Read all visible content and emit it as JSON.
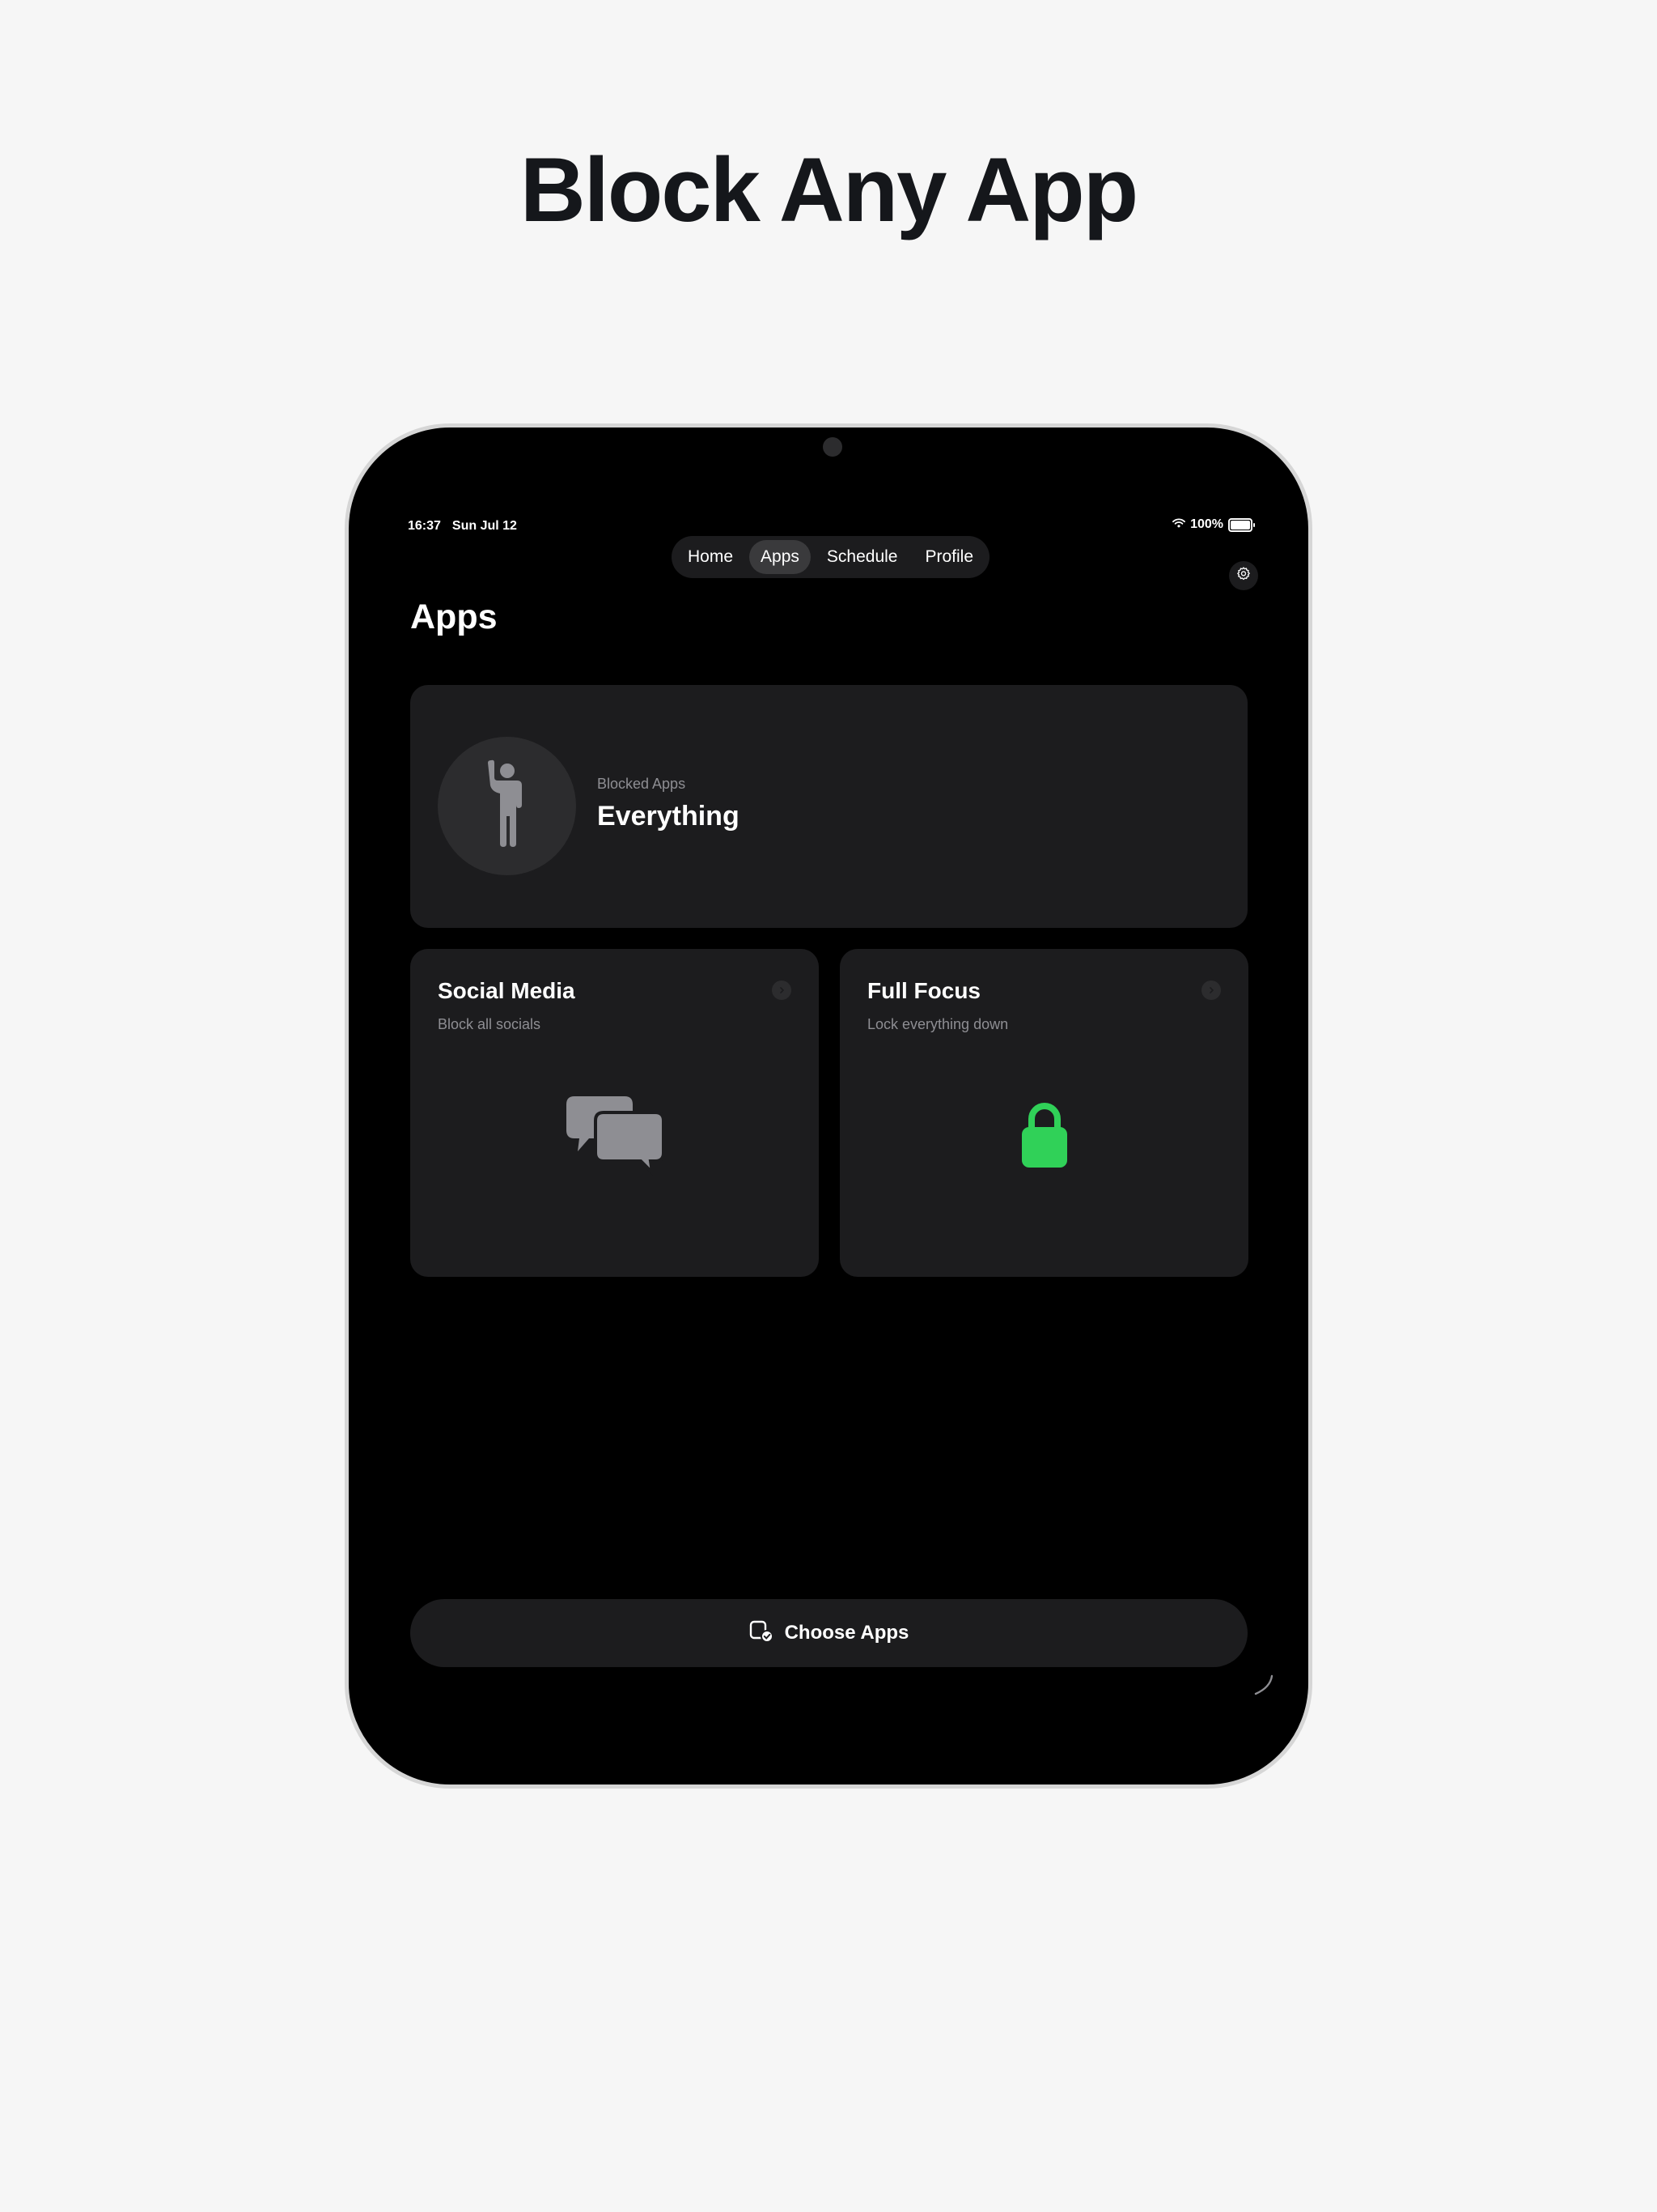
{
  "marketing": {
    "headline": "Block Any App"
  },
  "status_bar": {
    "time": "16:37",
    "date": "Sun Jul 12",
    "battery": "100%",
    "wifi_icon": "wifi-icon",
    "battery_icon": "battery-icon"
  },
  "nav": {
    "tabs": [
      {
        "label": "Home",
        "active": false
      },
      {
        "label": "Apps",
        "active": true
      },
      {
        "label": "Schedule",
        "active": false
      },
      {
        "label": "Profile",
        "active": false
      }
    ],
    "settings_icon": "gear-icon"
  },
  "page": {
    "title": "Apps"
  },
  "blocked_card": {
    "label": "Blocked Apps",
    "value": "Everything",
    "icon": "person-waving-icon"
  },
  "presets": [
    {
      "title": "Social Media",
      "subtitle": "Block all socials",
      "icon": "chat-bubbles-icon",
      "icon_color": "#8e8e93"
    },
    {
      "title": "Full Focus",
      "subtitle": "Lock everything down",
      "icon": "lock-icon",
      "icon_color": "#30d158"
    }
  ],
  "actions": {
    "choose_apps_label": "Choose Apps",
    "choose_apps_icon": "app-checkmark-icon"
  },
  "colors": {
    "page_background": "#f6f6f6",
    "screen_background": "#000000",
    "card_background": "#1c1c1e",
    "accent_green": "#30d158",
    "secondary_text": "#8e8e93"
  }
}
